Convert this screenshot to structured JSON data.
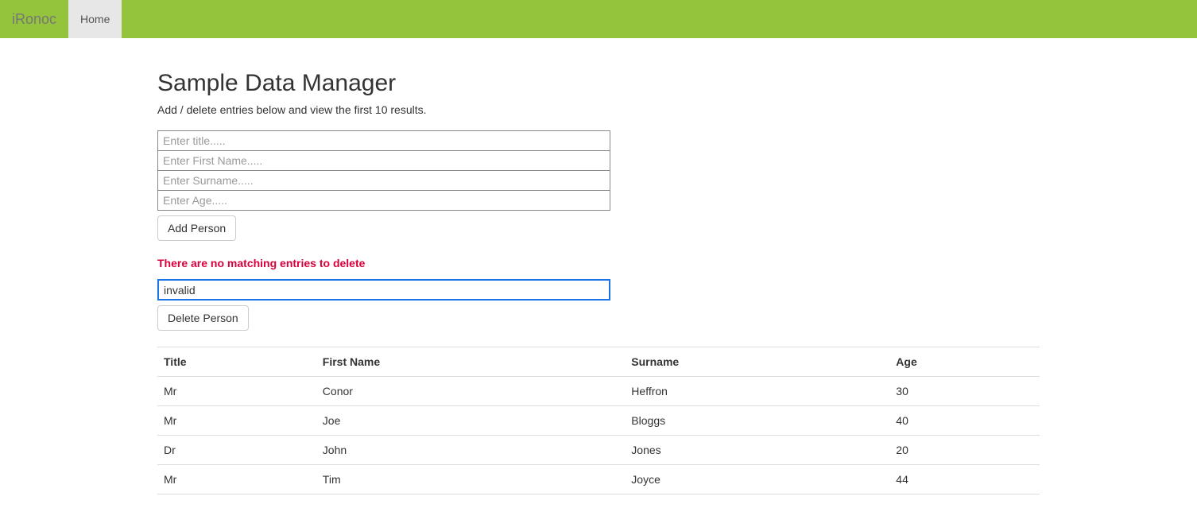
{
  "nav": {
    "brand": "iRonoc",
    "home": "Home"
  },
  "main": {
    "title": "Sample Data Manager",
    "subtitle": "Add / delete entries below and view the first 10 results.",
    "addForm": {
      "titlePlaceholder": "Enter title.....",
      "firstNamePlaceholder": "Enter First Name.....",
      "surnamePlaceholder": "Enter Surname.....",
      "agePlaceholder": "Enter Age.....",
      "addButton": "Add Person"
    },
    "deleteForm": {
      "errorMessage": "There are no matching entries to delete",
      "inputValue": "invalid",
      "deleteButton": "Delete Person"
    },
    "table": {
      "headers": {
        "title": "Title",
        "firstName": "First Name",
        "surname": "Surname",
        "age": "Age"
      },
      "rows": [
        {
          "title": "Mr",
          "firstName": "Conor",
          "surname": "Heffron",
          "age": "30"
        },
        {
          "title": "Mr",
          "firstName": "Joe",
          "surname": "Bloggs",
          "age": "40"
        },
        {
          "title": "Dr",
          "firstName": "John",
          "surname": "Jones",
          "age": "20"
        },
        {
          "title": "Mr",
          "firstName": "Tim",
          "surname": "Joyce",
          "age": "44"
        }
      ]
    }
  }
}
